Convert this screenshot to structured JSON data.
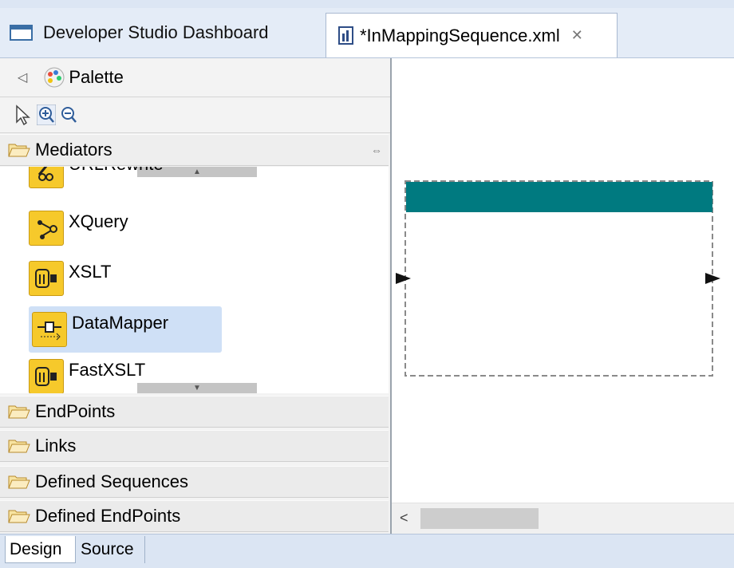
{
  "editor_tabs": [
    {
      "label": "Developer Studio Dashboard",
      "active": false
    },
    {
      "label": "*InMappingSequence.xml",
      "active": true
    }
  ],
  "palette": {
    "title": "Palette",
    "drawers": {
      "mediators": "Mediators",
      "endpoints": "EndPoints",
      "links": "Links",
      "defined_sequences": "Defined Sequences",
      "defined_endpoints": "Defined EndPoints"
    },
    "mediators": [
      {
        "label": "URLRewrite",
        "icon": "url-rewrite-icon"
      },
      {
        "label": "XQuery",
        "icon": "xquery-icon"
      },
      {
        "label": "XSLT",
        "icon": "xslt-icon"
      },
      {
        "label": "DataMapper",
        "icon": "datamapper-icon",
        "selected": true
      },
      {
        "label": "FastXSLT",
        "icon": "fastxslt-icon"
      }
    ]
  },
  "canvas": {
    "sequence_color": "#007a80"
  },
  "bottom_tabs": [
    "Design",
    "Source"
  ],
  "colors": {
    "accent": "#007a80",
    "mediator_icon": "#f6c92b",
    "selection": "#cfe0f6"
  }
}
